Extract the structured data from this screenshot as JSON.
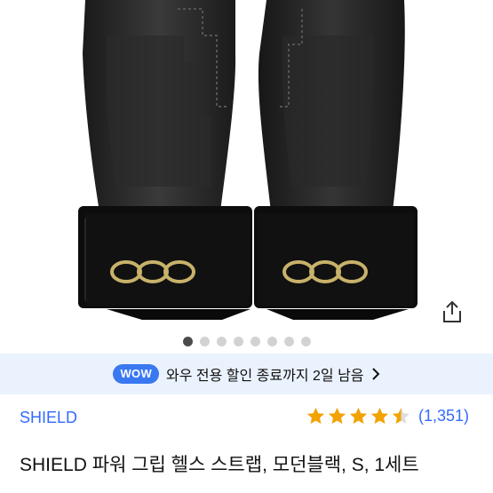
{
  "image": {
    "alt": "",
    "logo_color": "#c8b26a"
  },
  "carousel": {
    "count": 8,
    "active_index": 0
  },
  "promo": {
    "badge": "WOW",
    "text": "와우 전용 할인 종료까지 2일 남음",
    "badge_color": "#3a78f2",
    "background": "#eaf2fd"
  },
  "product": {
    "brand": "SHIELD",
    "rating": 4.5,
    "rating_max": 5,
    "review_count": "(1,351)",
    "title": "SHIELD 파워 그립 헬스 스트랩, 모던블랙, S, 1세트",
    "star_color": "#f2a300",
    "link_color": "#346aff"
  },
  "icons": {
    "share": "share-icon",
    "chevron": "chevron-right-icon",
    "star": "star-icon"
  }
}
